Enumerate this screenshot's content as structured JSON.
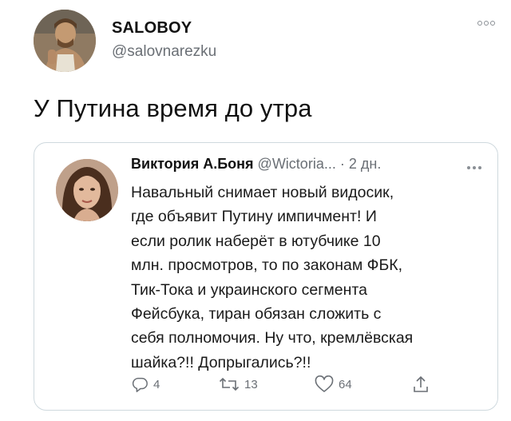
{
  "author": {
    "name": "SALOBOY",
    "handle": "@salovnarezku"
  },
  "tweet": {
    "text": "У Путина время до утра"
  },
  "quoted": {
    "name": "Виктория А.Боня",
    "handle": "@Wictoria...",
    "separator": "·",
    "time": "2 дн.",
    "text": "Навальный снимает новый видосик,\nгде объявит Путину импичмент! И\nесли ролик наберёт в ютубчике 10\nмлн. просмотров, то по законам ФБК,\nТик-Тока и украинского сегмента\nФейсбука, тиран обязан сложить с\nсебя полномочия. Ну что, кремлёвская\nшайка?!! Допрыгались?!!",
    "actions": {
      "replies": "4",
      "retweets": "13",
      "likes": "64"
    }
  },
  "icons": {
    "more": "more-icon",
    "reply": "reply-icon",
    "retweet": "retweet-icon",
    "like": "heart-icon",
    "share": "share-icon"
  },
  "colors": {
    "text": "#111111",
    "secondary": "#6a6f75",
    "border": "#cfd9de"
  }
}
